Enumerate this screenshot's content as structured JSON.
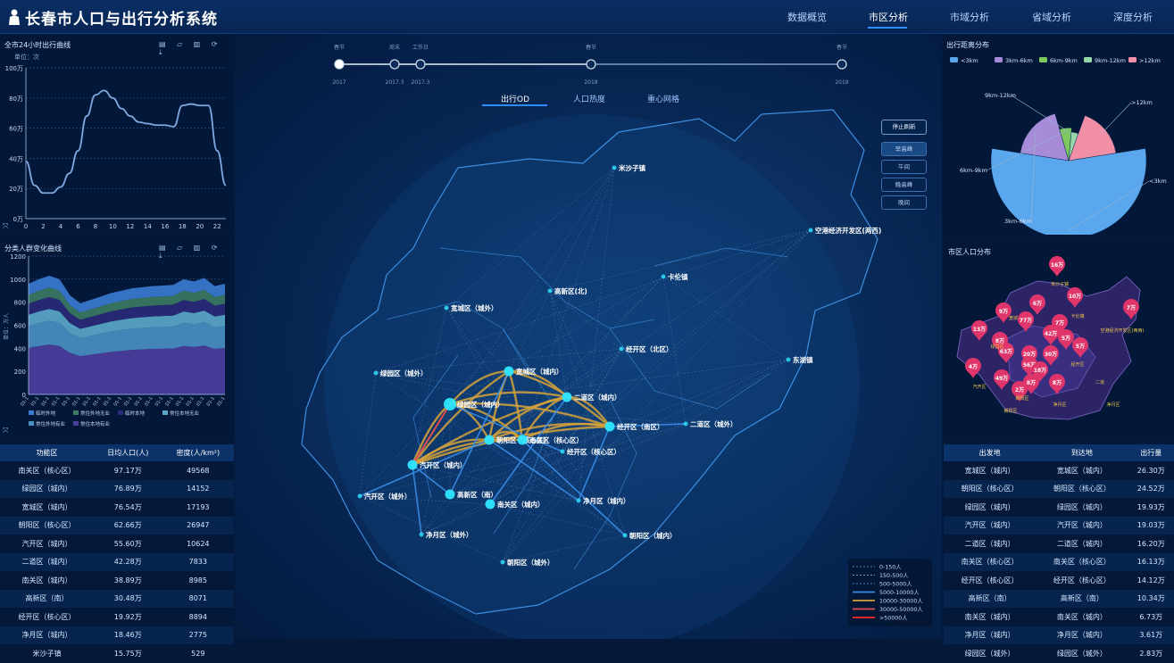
{
  "header": {
    "title": "长春市人口与出行分析系统",
    "nav": [
      {
        "label": "数据概览",
        "active": false
      },
      {
        "label": "市区分析",
        "active": true
      },
      {
        "label": "市域分析",
        "active": false
      },
      {
        "label": "省域分析",
        "active": false
      },
      {
        "label": "深度分析",
        "active": false
      }
    ]
  },
  "chart1": {
    "title": "全市24小时出行曲线",
    "unit": "单位：次",
    "tools": "▤ ▱ ▥ ⟳ ⤓",
    "yticks": [
      "100万",
      "80万",
      "60万",
      "40万",
      "20万",
      "0万"
    ],
    "xticks": [
      "0",
      "2",
      "4",
      "6",
      "8",
      "10",
      "12",
      "14",
      "16",
      "18",
      "20",
      "22"
    ]
  },
  "chart2": {
    "title": "分类人群变化曲线",
    "ylabel": "单位：万人",
    "tools": "▤ ▱ ▥ ⟳ ⤓",
    "yticks": [
      "1200",
      "1000",
      "800",
      "600",
      "400",
      "200",
      "0"
    ],
    "legend": [
      "临时外地",
      "常住外地无业",
      "临时本地",
      "常住本地无业",
      "常住外地有业",
      "常住本地有业"
    ]
  },
  "chart_data": [
    {
      "type": "line",
      "title": "全市24小时出行曲线",
      "ylabel": "单位：次",
      "x": [
        0,
        1,
        2,
        3,
        4,
        5,
        6,
        7,
        8,
        9,
        10,
        11,
        12,
        13,
        14,
        15,
        16,
        17,
        18,
        19,
        20,
        21,
        22,
        23
      ],
      "values": [
        38,
        22,
        17,
        17,
        21,
        30,
        45,
        68,
        82,
        85,
        80,
        73,
        68,
        64,
        63,
        62,
        62,
        61,
        75,
        76,
        75,
        75,
        45,
        22
      ],
      "ylim": [
        0,
        100
      ],
      "xlim": [
        0,
        23
      ],
      "grid": true
    },
    {
      "type": "area",
      "title": "分类人群变化曲线",
      "ylabel": "单位：万人",
      "ylim": [
        0,
        1200
      ],
      "series": [
        {
          "name": "常住本地有业",
          "color": "#4b3f9e"
        },
        {
          "name": "常住外地有业",
          "color": "#4a8fc2"
        },
        {
          "name": "常住本地无业",
          "color": "#5aa7c9"
        },
        {
          "name": "临时本地",
          "color": "#2a2a7a"
        },
        {
          "name": "常住外地无业",
          "color": "#3a7a62"
        },
        {
          "name": "临时外地",
          "color": "#3b7bd0"
        }
      ],
      "totals": [
        960,
        1000,
        1030,
        1000,
        860,
        790,
        820,
        850,
        880,
        900,
        920,
        930,
        940,
        945,
        950,
        1000,
        980,
        1010,
        940,
        960
      ]
    },
    {
      "type": "pie",
      "title": "出行距离分布",
      "categories": [
        "<3km",
        "3km-6km",
        "6km-9km",
        "9km-12km",
        ">12km"
      ],
      "values": [
        55,
        18,
        6,
        4,
        17
      ],
      "colors": [
        "#5aa7ee",
        "#a68bd8",
        "#7cc85f",
        "#97d6a9",
        "#f08fa6"
      ],
      "legend": "top"
    }
  ],
  "timeline": {
    "top_labels": [
      "春节",
      "周末",
      "工作日",
      "春节",
      "春节"
    ],
    "bottom_labels": [
      "2017",
      "2017.3",
      "2017.3",
      "2018",
      "2019"
    ]
  },
  "map": {
    "tabs": [
      "出行OD",
      "人口热度",
      "重心网格"
    ],
    "controls": [
      "停止刷新",
      "早高峰",
      "午间",
      "晚高峰",
      "晚间"
    ],
    "places": [
      "米沙子镇",
      "空港经济开发区(两西)",
      "卡伦镇",
      "高新区(北)",
      "宽城区（城外）",
      "经开区（北区）",
      "东湖镇",
      "绿园区（城外）",
      "宽城区（城内）",
      "二道区（城内）",
      "绿园区（城内）",
      "朝阳区（核心区）",
      "南关区（核心区）",
      "经开区（南区）",
      "二道区（城外）",
      "经开区（核心区）",
      "汽开区（城内）",
      "汽开区（城外）",
      "高新区（南）",
      "南关区（城内）",
      "净月区（城内）",
      "朝阳区（城内）",
      "净月区（城外）",
      "朝阳区（城外）"
    ],
    "legend": [
      "0-150人",
      "150-500人",
      "500-5000人",
      "5000-10000人",
      "10000-30000人",
      "30000-50000人",
      ">50000人"
    ],
    "legend_colors": [
      "#5d7fa8",
      "#7aa0c8",
      "#2f7cd0",
      "#3a8ee8",
      "#d6a23a",
      "#e05050",
      "#ff2a2a"
    ]
  },
  "pie": {
    "title": "出行距离分布",
    "legend": [
      "<3km",
      "3km-6km",
      "6km-9km",
      "9km-12km",
      ">12km"
    ],
    "labels": [
      "9km-12km",
      ">12km",
      "6km-9km",
      "<3km",
      "3km-6km"
    ]
  },
  "popmap": {
    "title": "市区人口分布",
    "markers": [
      "16万",
      "9万",
      "6万",
      "10万",
      "7万",
      "13万",
      "77万",
      "42万",
      "8万",
      "5万",
      "5万",
      "63万",
      "20万",
      "4万",
      "56万",
      "30万",
      "18万",
      "49万",
      "8万",
      "8万",
      "2万",
      "7万"
    ],
    "labels": [
      "米沙子镇",
      "宽城",
      "卡伦镇",
      "空港经济开发区(两西)",
      "绿园区",
      "经开区",
      "朝阳区",
      "二道",
      "净月区",
      "汽开区",
      "朝阳区",
      "净月区"
    ]
  },
  "table_left": {
    "headers": [
      "功能区",
      "日均人口(人)",
      "密度(人/km²)"
    ],
    "rows": [
      [
        "南关区（核心区）",
        "97.17万",
        "49568"
      ],
      [
        "绿园区（城内）",
        "76.89万",
        "14152"
      ],
      [
        "宽城区（城内）",
        "76.54万",
        "17193"
      ],
      [
        "朝阳区（核心区）",
        "62.66万",
        "26947"
      ],
      [
        "汽开区（城内）",
        "55.60万",
        "10624"
      ],
      [
        "二道区（城内）",
        "42.28万",
        "7833"
      ],
      [
        "南关区（城内）",
        "38.89万",
        "8985"
      ],
      [
        "高新区（南）",
        "30.48万",
        "8071"
      ],
      [
        "经开区（核心区）",
        "19.92万",
        "8894"
      ],
      [
        "净月区（城内）",
        "18.46万",
        "2775"
      ],
      [
        "米沙子镇",
        "15.75万",
        "529"
      ]
    ]
  },
  "table_right": {
    "headers": [
      "出发地",
      "到达地",
      "出行量"
    ],
    "rows": [
      [
        "宽城区（城内）",
        "宽城区（城内）",
        "26.30万"
      ],
      [
        "朝阳区（核心区）",
        "朝阳区（核心区）",
        "24.52万"
      ],
      [
        "绿园区（城内）",
        "绿园区（城内）",
        "19.93万"
      ],
      [
        "汽开区（城内）",
        "汽开区（城内）",
        "19.03万"
      ],
      [
        "二道区（城内）",
        "二道区（城内）",
        "16.20万"
      ],
      [
        "南关区（核心区）",
        "南关区（核心区）",
        "16.13万"
      ],
      [
        "经开区（核心区）",
        "经开区（核心区）",
        "14.12万"
      ],
      [
        "高新区（南）",
        "高新区（南）",
        "10.34万"
      ],
      [
        "南关区（城内）",
        "南关区（城内）",
        "6.73万"
      ],
      [
        "净月区（城内）",
        "净月区（城内）",
        "3.61万"
      ],
      [
        "绿园区（城外）",
        "绿园区（城外）",
        "2.83万"
      ]
    ]
  }
}
